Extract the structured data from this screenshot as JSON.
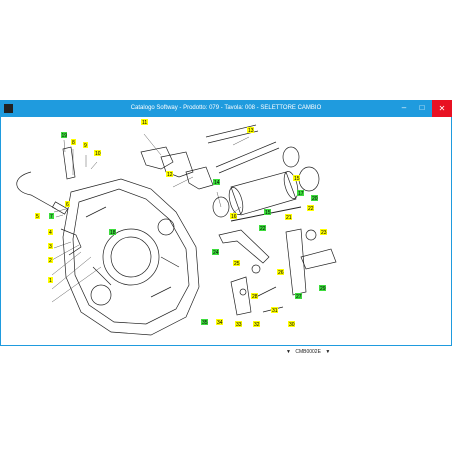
{
  "window": {
    "title": "Catalogo Softway - Prodotto: 079 - Tavola: 008 - SELETTORE CAMBIO",
    "minimize": "–",
    "maximize": "□",
    "close": "✕"
  },
  "footer": {
    "prev": "▼",
    "code": "CMB0002E",
    "next": "▼"
  },
  "labels_yellow": [
    "11",
    "13",
    "9",
    "8",
    "10",
    "12",
    "14",
    "16",
    "5",
    "7",
    "6",
    "4",
    "3",
    "2",
    "1",
    "15",
    "22",
    "21",
    "23",
    "24",
    "25",
    "26",
    "27",
    "28",
    "34",
    "33",
    "32",
    "31",
    "30"
  ],
  "labels_green": [
    "19",
    "18",
    "17",
    "20",
    "29",
    "35"
  ],
  "callouts": {
    "l11": "11",
    "l13": "13",
    "l9": "9",
    "l8": "8",
    "l10": "10",
    "l12": "12",
    "l14": "14",
    "l16": "16",
    "l5": "5",
    "l7": "7",
    "l6": "6",
    "l4": "4",
    "l3": "3",
    "l2": "2",
    "l1": "1",
    "l15": "15",
    "l22": "22",
    "l21": "21",
    "l23": "23",
    "l24": "24",
    "l25": "25",
    "l26": "26",
    "l27": "27",
    "l28": "28",
    "l34": "34",
    "l33": "33",
    "l32": "32",
    "l31": "31",
    "l30": "30",
    "l19": "19",
    "l18": "18",
    "l17": "17",
    "l20": "20",
    "l29": "29",
    "l35": "35",
    "l22b": "22",
    "l15b": "15"
  }
}
